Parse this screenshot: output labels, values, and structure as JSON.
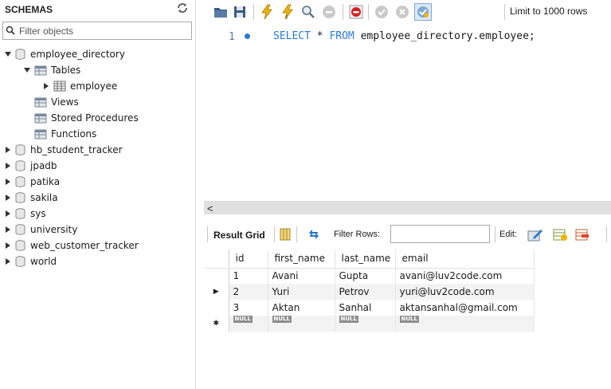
{
  "sidebar": {
    "title": "SCHEMAS",
    "filter_placeholder": "Filter objects",
    "schemas": [
      {
        "name": "employee_directory",
        "expanded": true
      },
      {
        "name": "hb_student_tracker",
        "expanded": false
      },
      {
        "name": "jpadb",
        "expanded": false
      },
      {
        "name": "patika",
        "expanded": false
      },
      {
        "name": "sakila",
        "expanded": false
      },
      {
        "name": "sys",
        "expanded": false
      },
      {
        "name": "university",
        "expanded": false
      },
      {
        "name": "web_customer_tracker",
        "expanded": false
      },
      {
        "name": "world",
        "expanded": false
      }
    ],
    "employee_directory_children": {
      "tables": "Tables",
      "table_items": [
        "employee"
      ],
      "views": "Views",
      "stored_procedures": "Stored Procedures",
      "functions": "Functions"
    }
  },
  "toolbar": {
    "limit_label": "Limit to 1000 rows",
    "icons": [
      "open-folder-icon",
      "save-icon",
      "execute-icon",
      "execute-current-icon",
      "explain-icon",
      "stop-icon",
      "toggle-error-icon",
      "commit-icon",
      "rollback-icon",
      "autocommit-icon"
    ]
  },
  "editor": {
    "line_number": "1",
    "sql": {
      "kw1": "SELECT",
      "star": " * ",
      "kw2": "FROM",
      "target": " employee_directory.employee;"
    }
  },
  "scrollbar": {
    "left_arrow": "<"
  },
  "result_toolbar": {
    "result_grid_label": "Result Grid",
    "filter_rows_label": "Filter Rows:",
    "filter_rows_value": "",
    "edit_label": "Edit:"
  },
  "result": {
    "columns": [
      "id",
      "first_name",
      "last_name",
      "email"
    ],
    "rows": [
      [
        "1",
        "Avani",
        "Gupta",
        "avani@luv2code.com"
      ],
      [
        "2",
        "Yuri",
        "Petrov",
        "yuri@luv2code.com"
      ],
      [
        "3",
        "Aktan",
        "Sanhal",
        "aktansanhal@gmail.com"
      ]
    ],
    "null_label": "NULL",
    "current_row_marker": "▶",
    "new_row_marker": "✱"
  },
  "colors": {
    "keyword": "#2a7ad5",
    "null_badge": "#8e8e8e",
    "scrollbar": "#e0e0e0"
  }
}
